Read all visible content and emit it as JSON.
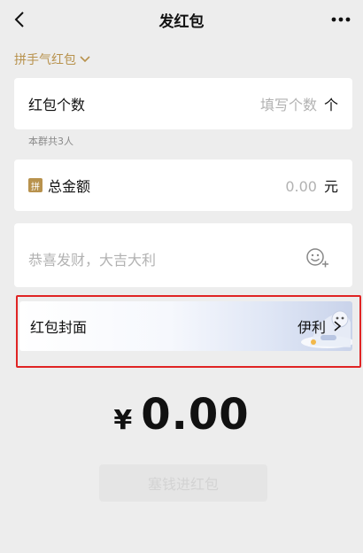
{
  "nav": {
    "title": "发红包",
    "back_icon": "chevron-left-icon",
    "more_icon": "more-dots-icon"
  },
  "type_switch": {
    "label": "拼手气红包",
    "icon": "chevron-down-icon"
  },
  "count": {
    "label": "红包个数",
    "placeholder": "填写个数",
    "unit": "个",
    "hint": "本群共3人"
  },
  "total": {
    "badge": "拼",
    "label": "总金额",
    "value": "0.00",
    "unit": "元"
  },
  "greeting": {
    "placeholder": "恭喜发财，大吉大利",
    "emoji_icon": "emoji-add-icon"
  },
  "cover": {
    "label": "红包封面",
    "value": "伊利",
    "chevron_icon": "chevron-right-icon"
  },
  "amount": {
    "currency": "¥",
    "value": "0.00"
  },
  "send_button": {
    "label": "塞钱进红包"
  },
  "colors": {
    "accent_gold": "#b8924d",
    "highlight_red": "#e02424",
    "background": "#ededed"
  }
}
